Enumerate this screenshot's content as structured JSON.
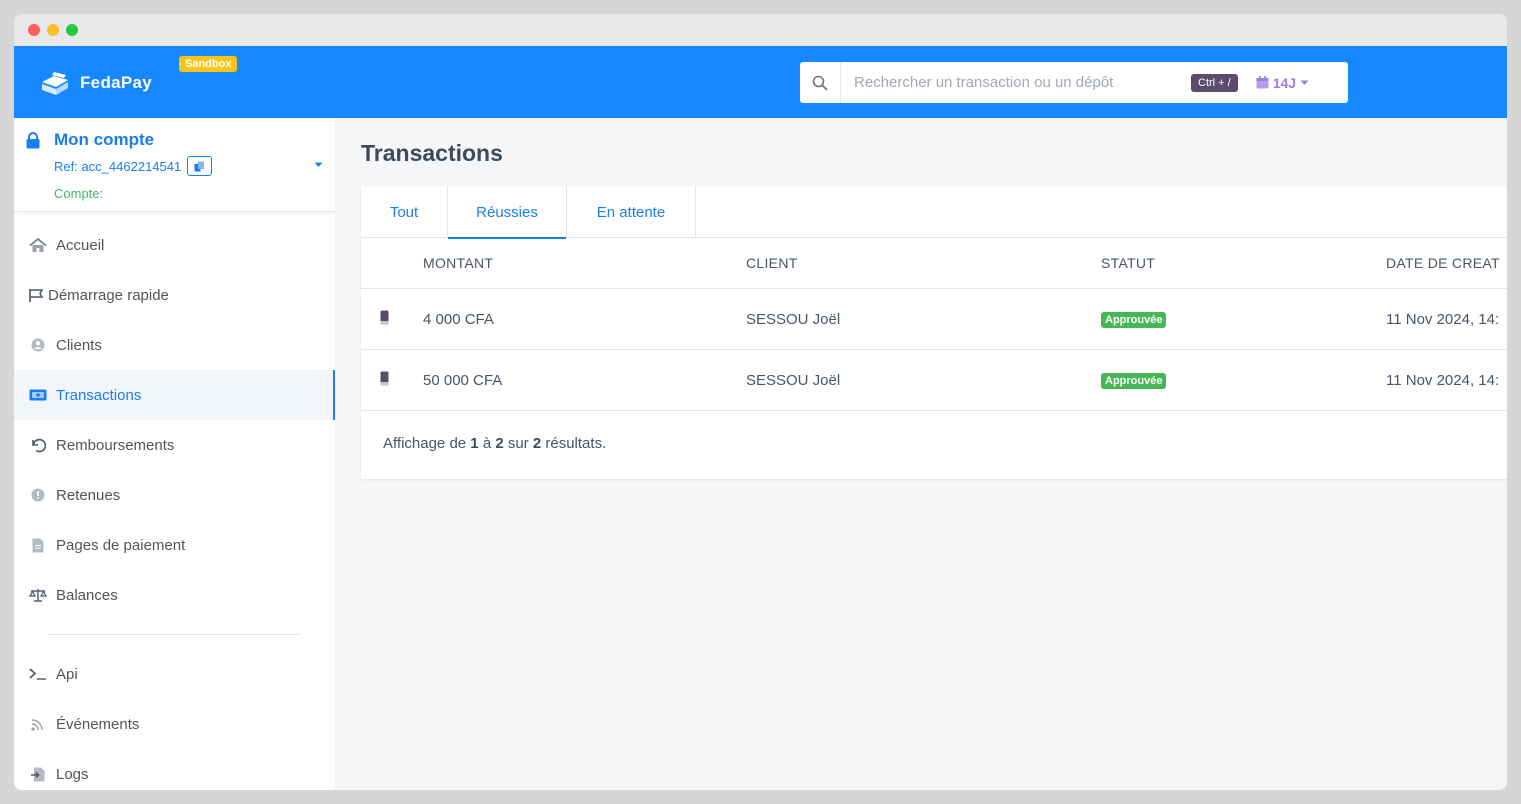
{
  "brand": {
    "name": "FedaPay",
    "env_badge": "Sandbox"
  },
  "search": {
    "placeholder": "Rechercher un transaction ou un dépôt",
    "shortcut": "Ctrl + /",
    "period": "14J"
  },
  "account": {
    "title": "Mon compte",
    "ref": "Ref: acc_4462214541",
    "type_label": "Compte:"
  },
  "sidebar": {
    "items": [
      {
        "label": "Accueil"
      },
      {
        "label": "Démarrage rapide"
      },
      {
        "label": "Clients"
      },
      {
        "label": "Transactions"
      },
      {
        "label": "Remboursements"
      },
      {
        "label": "Retenues"
      },
      {
        "label": "Pages de paiement"
      },
      {
        "label": "Balances"
      }
    ],
    "dev_items": [
      {
        "label": "Api"
      },
      {
        "label": "Événements"
      },
      {
        "label": "Logs"
      }
    ]
  },
  "main": {
    "title": "Transactions",
    "tabs": [
      {
        "label": "Tout"
      },
      {
        "label": "Réussies"
      },
      {
        "label": "En attente"
      }
    ],
    "columns": {
      "amount": "MONTANT",
      "client": "CLIENT",
      "status": "STATUT",
      "date": "DATE DE CREAT"
    },
    "rows": [
      {
        "amount": "4 000 CFA",
        "client": "SESSOU Joël",
        "status": "Approuvée",
        "date": "11 Nov 2024, 14:"
      },
      {
        "amount": "50 000 CFA",
        "client": "SESSOU Joël",
        "status": "Approuvée",
        "date": "11 Nov 2024, 14:"
      }
    ],
    "pagination": {
      "prefix": "Affichage de",
      "from": "1",
      "to_word": "à",
      "to": "2",
      "of_word": "sur",
      "total": "2",
      "suffix": "résultats."
    }
  },
  "colors": {
    "brand_blue": "#1888ff",
    "link_blue": "#1a7ef0",
    "success": "#45b754",
    "sandbox": "#f5c518",
    "accent_purple": "#9e7fe0"
  }
}
